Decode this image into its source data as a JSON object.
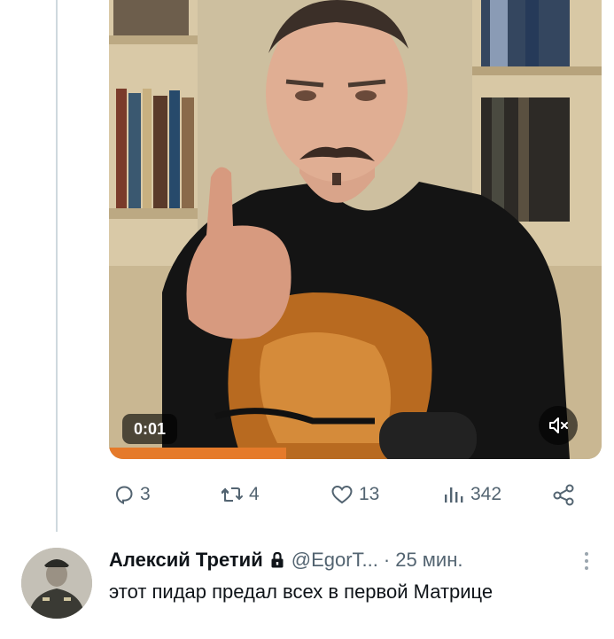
{
  "tweet": {
    "video": {
      "timestamp": "0:01",
      "mute_icon": "speaker-muted-icon"
    },
    "actions": {
      "reply": {
        "icon": "reply-icon",
        "count": "3"
      },
      "retweet": {
        "icon": "retweet-icon",
        "count": "4"
      },
      "like": {
        "icon": "heart-icon",
        "count": "13"
      },
      "views": {
        "icon": "views-icon",
        "count": "342"
      },
      "share": {
        "icon": "share-icon"
      }
    }
  },
  "reply": {
    "author_name": "Алексий Третий",
    "lock_icon": "lock-icon",
    "handle": "@EgorT...",
    "separator": "·",
    "time": "25 мин.",
    "text": "этот пидар предал всех в первой Матрице"
  },
  "colors": {
    "muted_text": "#536471",
    "primary_text": "#0f1419",
    "thread_line": "#cfd9de"
  }
}
